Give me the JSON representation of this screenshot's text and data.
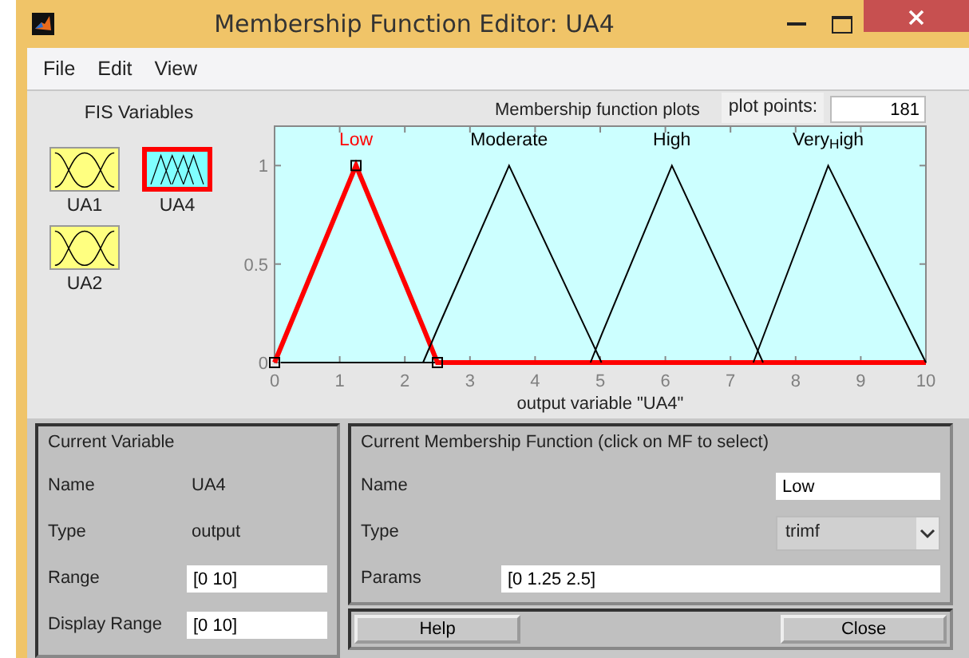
{
  "window": {
    "title": "Membership Function Editor: UA4"
  },
  "menu": [
    "File",
    "Edit",
    "View"
  ],
  "fis_variables": {
    "title": "FIS Variables",
    "items": [
      {
        "label": "UA1",
        "kind": "input",
        "selected": false
      },
      {
        "label": "UA4",
        "kind": "output",
        "selected": true
      },
      {
        "label": "UA2",
        "kind": "input",
        "selected": false
      }
    ]
  },
  "plot": {
    "title": "Membership function plots",
    "plot_points_label": "plot points:",
    "plot_points": "181",
    "mf_selection": [
      {
        "selected": true
      },
      {
        "selected": false
      },
      {
        "selected": false
      },
      {
        "selected": false
      }
    ],
    "chart_data": {
      "type": "line",
      "xlabel": "output variable \"UA4\"",
      "x": [
        0,
        1.25,
        2.28,
        2.5,
        3.6,
        4.85,
        5.02,
        6.1,
        7.35,
        7.5,
        8.5,
        10
      ],
      "series": [
        {
          "name": "Low",
          "color": "#ff0000",
          "values": [
            0,
            1,
            0.18,
            0,
            0,
            0,
            0,
            0,
            0,
            0,
            0,
            0
          ]
        },
        {
          "name": "Moderate",
          "color": "#000000",
          "values": [
            null,
            null,
            0,
            0.17,
            1,
            0.12,
            0,
            null,
            null,
            null,
            null,
            null
          ]
        },
        {
          "name": "High",
          "color": "#000000",
          "values": [
            null,
            null,
            null,
            null,
            null,
            0,
            0.14,
            1,
            0.11,
            0,
            null,
            null
          ]
        },
        {
          "name": "Very$_{H}$igh",
          "color": "#000000",
          "values": [
            null,
            null,
            null,
            null,
            null,
            null,
            null,
            null,
            0,
            0.13,
            1,
            0
          ]
        }
      ],
      "xlim": [
        0,
        10
      ],
      "ylim": [
        0,
        1.2
      ],
      "xticks": [
        0,
        1,
        2,
        3,
        4,
        5,
        6,
        7,
        8,
        9,
        10
      ],
      "yticks": [
        0,
        0.5,
        1
      ]
    }
  },
  "current_variable": {
    "title": "Current Variable",
    "rows": [
      {
        "label": "Name",
        "value": "UA4",
        "kind": "text"
      },
      {
        "label": "Type",
        "value": "output",
        "kind": "text"
      },
      {
        "label": "Range",
        "value": "[0 10]",
        "kind": "field"
      },
      {
        "label": "Display Range",
        "value": "[0 10]",
        "kind": "field"
      }
    ]
  },
  "current_mf": {
    "title": "Current Membership Function (click on MF to select)",
    "name_label": "Name",
    "name": "Low",
    "type_label": "Type",
    "type": "trimf",
    "params_label": "Params",
    "params": "[0 1.25 2.5]"
  },
  "buttons": [
    "Help",
    "Close"
  ]
}
